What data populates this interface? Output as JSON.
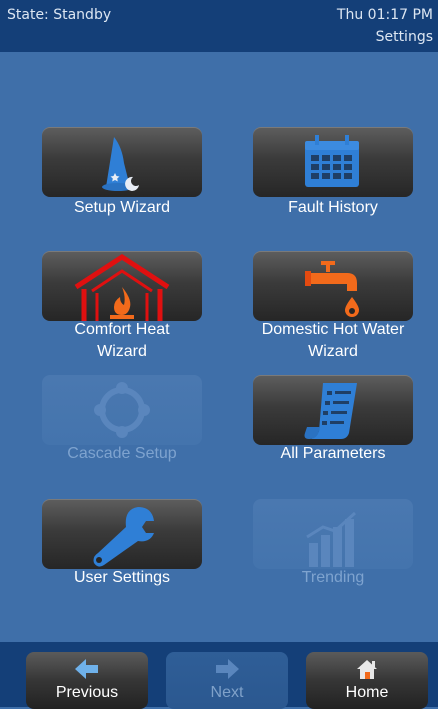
{
  "status": {
    "state": "State: Standby",
    "datetime": "Thu 01:17 PM",
    "screen_title": "Settings"
  },
  "tiles": {
    "setup_wizard": {
      "label": "Setup Wizard",
      "icon": "wizard-hat-icon"
    },
    "fault_history": {
      "label": "Fault History",
      "icon": "calendar-icon"
    },
    "comfort_heat": {
      "label_line1": "Comfort Heat",
      "label_line2": "Wizard",
      "icon": "house-flame-icon"
    },
    "dhw": {
      "label_line1": "Domestic Hot Water",
      "label_line2": "Wizard",
      "icon": "faucet-icon"
    },
    "cascade_setup": {
      "label": "Cascade Setup",
      "icon": "cascade-icon",
      "enabled": false
    },
    "all_parameters": {
      "label": "All Parameters",
      "icon": "document-list-icon"
    },
    "user_settings": {
      "label": "User Settings",
      "icon": "wrench-icon"
    },
    "trending": {
      "label": "Trending",
      "icon": "chart-icon",
      "enabled": false
    }
  },
  "nav": {
    "previous": "Previous",
    "next": "Next",
    "home": "Home"
  },
  "colors": {
    "background": "#3f6fa9",
    "header": "#143f78",
    "flame_red": "#e01010",
    "faucet_orange": "#f26a1b",
    "icon_blue": "#2f7fd6",
    "disabled_text": "#7ea3cf"
  }
}
